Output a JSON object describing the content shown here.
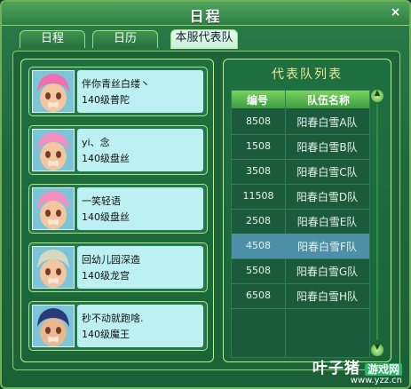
{
  "window": {
    "title": "日程",
    "close_glyph": "×"
  },
  "tabs": [
    {
      "label": "日程"
    },
    {
      "label": "日历"
    },
    {
      "label": "本服代表队",
      "active": true
    }
  ],
  "members": [
    {
      "name": "伴你青丝白缕丶",
      "level": "140级普陀",
      "hair": "#f06fb0",
      "skin": "#f3c6a0"
    },
    {
      "name": "yi、念",
      "level": "140级盘丝",
      "hair": "#f58fc2",
      "skin": "#f3c6a0"
    },
    {
      "name": "一笑轻语",
      "level": "140级盘丝",
      "hair": "#f58fc2",
      "skin": "#f3c6a0"
    },
    {
      "name": "回幼儿园深造",
      "level": "140级龙宫",
      "hair": "#d8d8c0",
      "skin": "#f0c5a0"
    },
    {
      "name": "秒不动就跑啥.",
      "level": "140级魔王",
      "hair": "#2a3a78",
      "skin": "#e8b890"
    }
  ],
  "team_list": {
    "title": "代表队列表",
    "col_id": "编号",
    "col_name": "队伍名称",
    "rows": [
      {
        "id": "8508",
        "name": "阳春白雪A队"
      },
      {
        "id": "1508",
        "name": "阳春白雪B队"
      },
      {
        "id": "3508",
        "name": "阳春白雪C队"
      },
      {
        "id": "11508",
        "name": "阳春白雪D队"
      },
      {
        "id": "2508",
        "name": "阳春白雪E队"
      },
      {
        "id": "4508",
        "name": "阳春白雪F队",
        "selected": true
      },
      {
        "id": "5508",
        "name": "阳春白雪G队"
      },
      {
        "id": "6508",
        "name": "阳春白雪H队"
      }
    ]
  },
  "scroll": {
    "up_glyph": "▲",
    "down_glyph": "▼"
  },
  "watermark": {
    "brand": "叶子猪",
    "tag": "游戏网",
    "url": "www.yzz.cn"
  }
}
